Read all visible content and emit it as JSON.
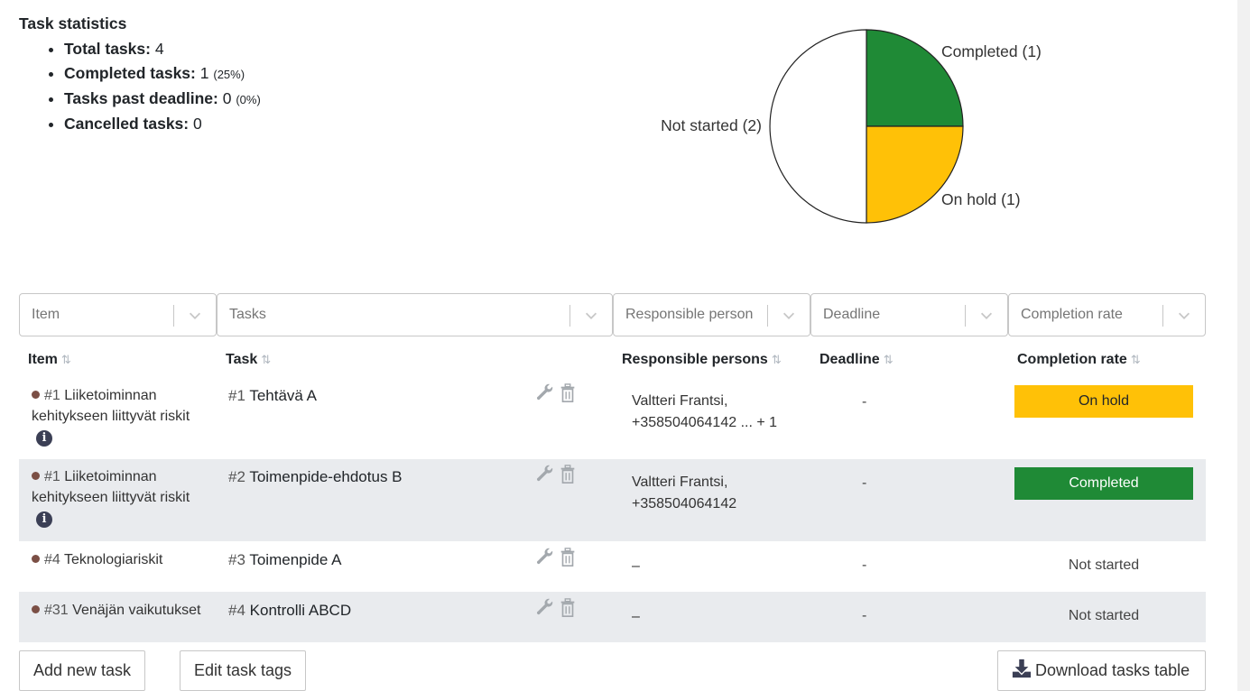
{
  "stats": {
    "title": "Task statistics",
    "total_label": "Total tasks:",
    "total_value": "4",
    "completed_label": "Completed tasks:",
    "completed_value": "1",
    "completed_pct": "(25%)",
    "past_label": "Tasks past deadline:",
    "past_value": "0",
    "past_pct": "(0%)",
    "cancelled_label": "Cancelled tasks:",
    "cancelled_value": "0"
  },
  "chart_data": {
    "type": "pie",
    "slices": [
      {
        "label": "Completed (1)",
        "value": 1,
        "color": "#1f8a36"
      },
      {
        "label": "On hold (1)",
        "value": 1,
        "color": "#ffc107"
      },
      {
        "label": "Not started (2)",
        "value": 2,
        "color": "#ffffff"
      }
    ]
  },
  "filters": {
    "item": "Item",
    "tasks": "Tasks",
    "responsible": "Responsible person",
    "deadline": "Deadline",
    "completion": "Completion rate"
  },
  "columns": {
    "item": "Item",
    "task": "Task",
    "responsible": "Responsible persons",
    "deadline": "Deadline",
    "completion": "Completion rate",
    "sort_glyph": "⇅"
  },
  "rows": [
    {
      "item_num": "#1",
      "item_name": "Liiketoiminnan kehitykseen liittyvät riskit",
      "has_info": true,
      "task_num": "#1",
      "task_name": "Tehtävä A",
      "resp_line1": "Valtteri Frantsi,",
      "resp_line2": "+358504064142 ... + 1",
      "deadline": "-",
      "status": "On hold",
      "status_kind": "hold"
    },
    {
      "item_num": "#1",
      "item_name": "Liiketoiminnan kehitykseen liittyvät riskit",
      "has_info": true,
      "task_num": "#2",
      "task_name": "Toimenpide-ehdotus B",
      "resp_line1": "Valtteri Frantsi,",
      "resp_line2": "+358504064142",
      "deadline": "-",
      "status": "Completed",
      "status_kind": "done"
    },
    {
      "item_num": "#4",
      "item_name": "Teknologiariskit",
      "has_info": false,
      "task_num": "#3",
      "task_name": "Toimenpide A",
      "resp_line1": "–",
      "resp_line2": "",
      "deadline": "-",
      "status": "Not started",
      "status_kind": "none"
    },
    {
      "item_num": "#31",
      "item_name": "Venäjän vaikutukset",
      "has_info": false,
      "task_num": "#4",
      "task_name": "Kontrolli ABCD",
      "resp_line1": "–",
      "resp_line2": "",
      "deadline": "-",
      "status": "Not started",
      "status_kind": "none"
    }
  ],
  "buttons": {
    "add": "Add new task",
    "edit_tags": "Edit task tags",
    "download": "Download tasks table"
  },
  "icons": {
    "info": "i",
    "edit": "wrench-icon",
    "delete": "trash-icon",
    "download": "download-icon",
    "dropdown": "chevron-down-icon"
  }
}
